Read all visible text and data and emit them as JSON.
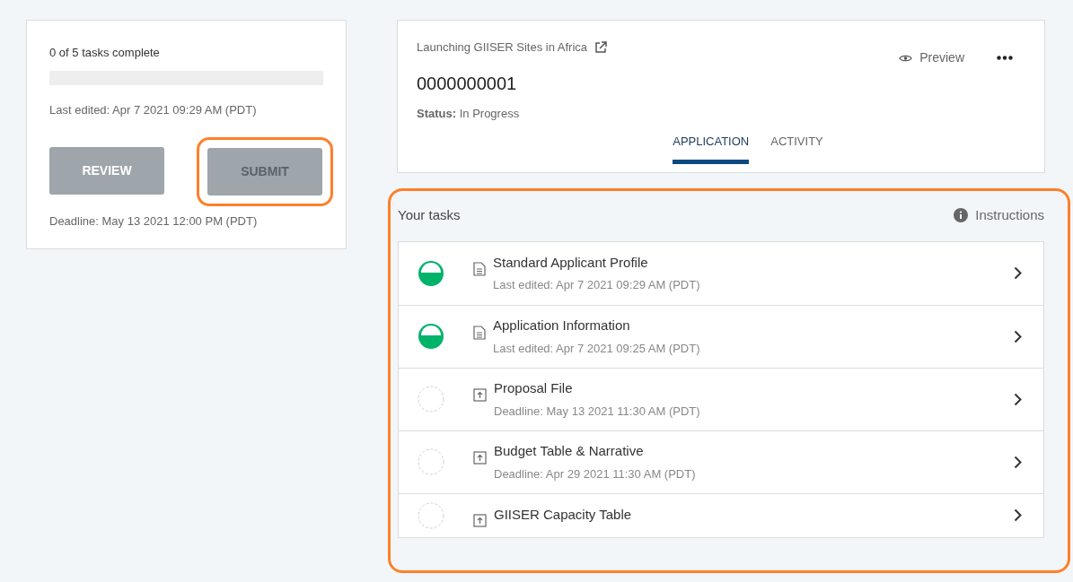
{
  "summary": {
    "progress_text": "0 of 5 tasks complete",
    "progress": {
      "level": 0
    },
    "last_edited": "Last edited: Apr 7 2021 09:29 AM (PDT)",
    "buttons": [
      {
        "label": "REVIEW",
        "disabled": false,
        "highlighted": false
      },
      {
        "label": "SUBMIT",
        "disabled": true,
        "highlighted": true
      }
    ],
    "deadline": "Deadline: May 13 2021 12:00 PM (PDT)"
  },
  "header": {
    "program": "Launching GIISER Sites in Africa",
    "preview": "Preview",
    "id": "0000000001",
    "status": "**Status:** In Progress",
    "tabs": [
      {
        "label": "APPLICATION",
        "selected": true
      },
      {
        "label": "ACTIVITY",
        "selected": false
      }
    ]
  },
  "tasks": {
    "highlighted": true,
    "title": "Your tasks",
    "instructions": "Instructions",
    "items": [
      {
        "started": true,
        "kind": "form",
        "title": "Standard Applicant Profile",
        "subtitle": "Last edited: Apr 7 2021 09:29 AM (PDT)"
      },
      {
        "started": true,
        "kind": "form",
        "title": "Application Information",
        "subtitle": "Last edited: Apr 7 2021 09:25 AM (PDT)"
      },
      {
        "started": false,
        "kind": "upload",
        "title": "Proposal File",
        "subtitle": "Deadline: May 13 2021 11:30 AM (PDT)"
      },
      {
        "started": false,
        "kind": "upload",
        "title": "Budget Table & Narrative",
        "subtitle": "Deadline: Apr 29 2021 11:30 AM (PDT)"
      },
      {
        "started": false,
        "kind": "upload",
        "title": "GIISER Capacity Table"
      }
    ]
  }
}
